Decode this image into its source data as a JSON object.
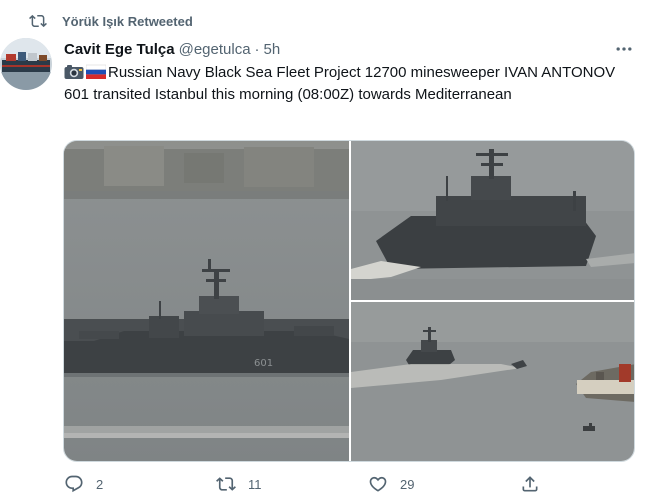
{
  "retweet_context": {
    "icon": "retweet-icon",
    "text": "Yörük Işık Retweeted"
  },
  "author": {
    "name": "Cavit Ege Tulça",
    "handle": "@egetulca",
    "separator": "·",
    "time": "5h",
    "avatar": "ship-avatar"
  },
  "tweet": {
    "emoji_1": "camera-emoji",
    "emoji_2": "russian-flag-emoji",
    "text": "Russian Navy Black Sea Fleet Project 12700 minesweeper IVAN ANTONOV 601 transited Istanbul this morning (08:00Z) towards Mediterranean"
  },
  "media": {
    "photos": [
      {
        "name": "minesweeper-side-view",
        "hull_number": "601"
      },
      {
        "name": "minesweeper-stern-view"
      },
      {
        "name": "minesweeper-distant-view"
      }
    ]
  },
  "actions": {
    "reply": {
      "icon": "reply-icon",
      "count": "2"
    },
    "retweet": {
      "icon": "retweet-icon",
      "count": "11"
    },
    "like": {
      "icon": "heart-icon",
      "count": "29"
    },
    "share": {
      "icon": "share-icon"
    }
  },
  "colors": {
    "text_primary": "#0f1419",
    "text_secondary": "#536471",
    "border": "#cfd9de"
  }
}
